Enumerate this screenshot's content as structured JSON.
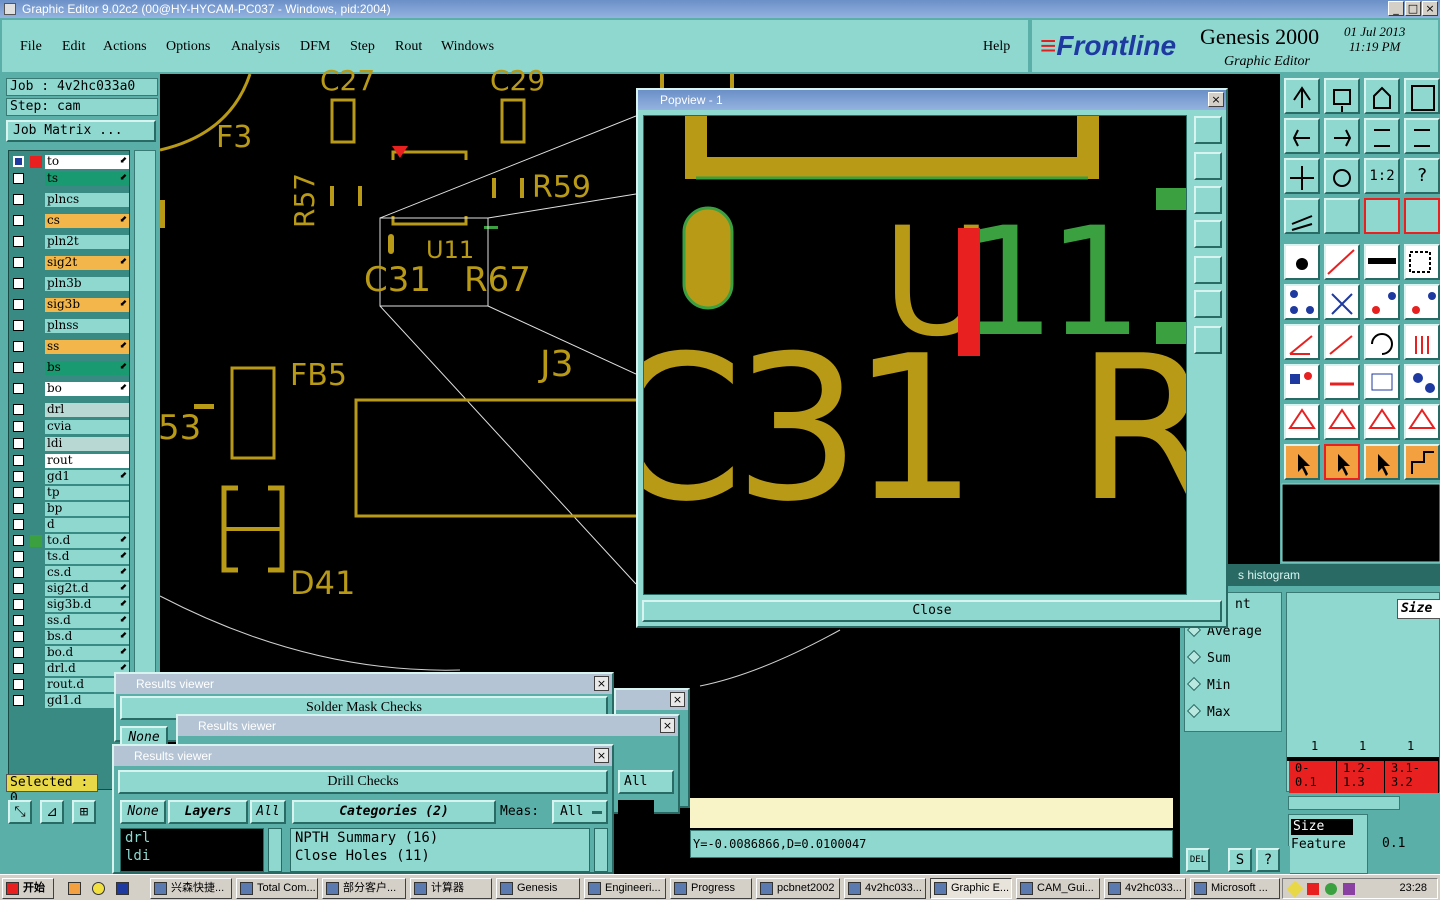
{
  "window": {
    "title": "Graphic Editor 9.02c2 (00@HY-HYCAM-PC037 - Windows, pid:2004)",
    "controls": [
      "_",
      "□",
      "×"
    ]
  },
  "menu": [
    "File",
    "Edit",
    "Actions",
    "Options",
    "Analysis",
    "DFM",
    "Step",
    "Rout",
    "Windows"
  ],
  "help_label": "Help",
  "brand": {
    "logo": "Frontline",
    "product": "Genesis 2000",
    "subtitle": "Graphic Editor",
    "date": "01 Jul 2013",
    "time": "11:19 PM"
  },
  "left": {
    "job": "Job : 4v2hc033a0",
    "step": "Step: cam",
    "job_matrix": "Job Matrix ...",
    "layers": [
      {
        "name": "to",
        "style": "white",
        "color": "#e82020",
        "mark": true
      },
      {
        "name": "ts",
        "style": "green",
        "mark": true
      },
      {
        "name": "plncs",
        "style": "teal"
      },
      {
        "name": "cs",
        "style": "yellow",
        "mark": true
      },
      {
        "name": "pln2t",
        "style": "teal"
      },
      {
        "name": "sig2t",
        "style": "yellow",
        "mark": true
      },
      {
        "name": "pln3b",
        "style": "teal"
      },
      {
        "name": "sig3b",
        "style": "yellow",
        "mark": true
      },
      {
        "name": "plnss",
        "style": "teal"
      },
      {
        "name": "ss",
        "style": "yellow",
        "mark": true
      },
      {
        "name": "bs",
        "style": "green",
        "mark": true
      },
      {
        "name": "bo",
        "style": "white",
        "mark": true
      },
      {
        "name": "drl",
        "style": "gray"
      },
      {
        "name": "cvia",
        "style": "teal"
      },
      {
        "name": "ldi",
        "style": "gray"
      },
      {
        "name": "rout",
        "style": "white"
      },
      {
        "name": "gd1",
        "style": "teal",
        "mark": true
      },
      {
        "name": "tp",
        "style": "teal"
      },
      {
        "name": "bp",
        "style": "teal"
      },
      {
        "name": "d",
        "style": "teal"
      },
      {
        "name": "to.d",
        "style": "teal",
        "color": "#3aa040",
        "mark": true
      },
      {
        "name": "ts.d",
        "style": "teal",
        "mark": true
      },
      {
        "name": "cs.d",
        "style": "teal",
        "mark": true
      },
      {
        "name": "sig2t.d",
        "style": "teal",
        "mark": true
      },
      {
        "name": "sig3b.d",
        "style": "teal",
        "mark": true
      },
      {
        "name": "ss.d",
        "style": "teal",
        "mark": true
      },
      {
        "name": "bs.d",
        "style": "teal",
        "mark": true
      },
      {
        "name": "bo.d",
        "style": "teal",
        "mark": true
      },
      {
        "name": "drl.d",
        "style": "teal",
        "mark": true
      },
      {
        "name": "rout.d",
        "style": "teal",
        "mark": true
      },
      {
        "name": "gd1.d",
        "style": "teal",
        "mark": true
      }
    ],
    "selected": "Selected : 0"
  },
  "pcb_labels": {
    "c27": "C27",
    "c29": "C29",
    "f3": "F3",
    "r57": "R57",
    "r59": "R59",
    "u11": "U11",
    "c31": "C31",
    "r67": "R67",
    "fb5": "FB5",
    "j3": "J3",
    "d41": "D41",
    "left_partial": "53"
  },
  "popview": {
    "title": "Popview - 1",
    "close_label": "Close",
    "zoom_u": "U",
    "zoom_11": "11",
    "zoom_c31": "C31",
    "zoom_r": "R"
  },
  "histogram": {
    "title": "s histogram",
    "options": [
      "nt",
      "Average",
      "Sum",
      "Min",
      "Max"
    ],
    "size_label": "Size",
    "counts": [
      "1",
      "1",
      "1"
    ],
    "bins": [
      "0-\n0.1",
      "1.2-\n1.3",
      "3.1-\n3.2"
    ],
    "size_field": "Size",
    "feature_label": "Feature",
    "value": "0.1"
  },
  "coords": "Y=-0.0086866,D=0.0100047",
  "results_viewers": [
    {
      "title": "Results viewer",
      "header": "Solder Mask Checks",
      "none_label": "None"
    },
    {
      "title": "Results viewer",
      "all_label": "All"
    },
    {
      "title": "Results viewer",
      "header": "Drill Checks",
      "none_label": "None",
      "layers_label": "Layers",
      "all_label": "All",
      "categories_label": "Categories (2)",
      "meas_label": "Meas:",
      "meas_value": "All",
      "layer_items": [
        "drl",
        "ldi"
      ],
      "category_items": [
        "NPTH Summary (16)",
        "Close Holes (11)"
      ]
    }
  ],
  "taskbar": {
    "start": "开始",
    "tasks": [
      "兴森快捷...",
      "Total Com...",
      "部分客户...",
      "计算器",
      "Genesis",
      "Engineeri...",
      "Progress",
      "pcbnet2002",
      "4v2hc033...",
      "Graphic E...",
      "CAM_Gui...",
      "4v2hc033...",
      "Microsoft ..."
    ],
    "clock": "23:28"
  },
  "colors": {
    "teal": "#8fd8d0",
    "teal_dark": "#5ab0a8",
    "pcb_gold": "#b89a16",
    "pcb_green": "#3aa040",
    "highlight_red": "#e82020"
  }
}
